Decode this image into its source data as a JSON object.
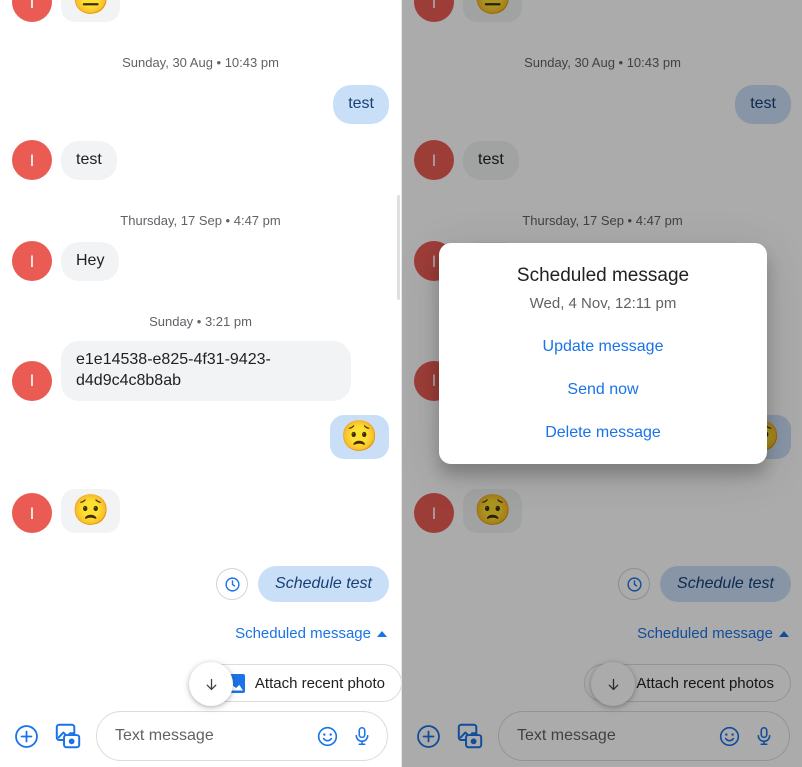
{
  "app": {
    "avatar_initial": "I"
  },
  "chat": {
    "top_partial_emoji": "😐",
    "date_sep_1": "Sunday, 30 Aug • 10:43 pm",
    "msg_out_1": "test",
    "msg_in_1": "test",
    "date_sep_2": "Thursday, 17 Sep • 4:47 pm",
    "msg_in_2": "Hey",
    "date_sep_3": "Sunday • 3:21 pm",
    "msg_in_3": "e1e14538-e825-4f31-9423-d4d9c4c8b8ab",
    "emoji_out": "😟",
    "emoji_in": "😟"
  },
  "schedule": {
    "bubble_text": "Schedule test",
    "label": "Scheduled message",
    "clock_icon": "clock-icon",
    "caret_icon": "caret-up-icon"
  },
  "attach": {
    "chip_label_left": "Attach recent photo",
    "chip_label_right": "Attach recent photos",
    "photo_icon": "photo-icon",
    "scroll_down_icon": "arrow-down-icon"
  },
  "composer": {
    "plus_icon": "plus-circle-icon",
    "gallery_icon": "gallery-camera-icon",
    "placeholder": "Text message",
    "emoji_icon": "emoji-smiley-icon",
    "mic_icon": "microphone-icon"
  },
  "dialog": {
    "title": "Scheduled message",
    "subtitle": "Wed, 4 Nov, 12:11 pm",
    "actions": [
      {
        "label": "Update message"
      },
      {
        "label": "Send now"
      },
      {
        "label": "Delete message"
      }
    ]
  },
  "colors": {
    "avatar_red": "#EA5B54",
    "outgoing_bubble": "#C9DFF8",
    "incoming_bubble": "#F1F3F4",
    "accent_blue": "#1a73e8",
    "outgoing_text": "#174176"
  }
}
